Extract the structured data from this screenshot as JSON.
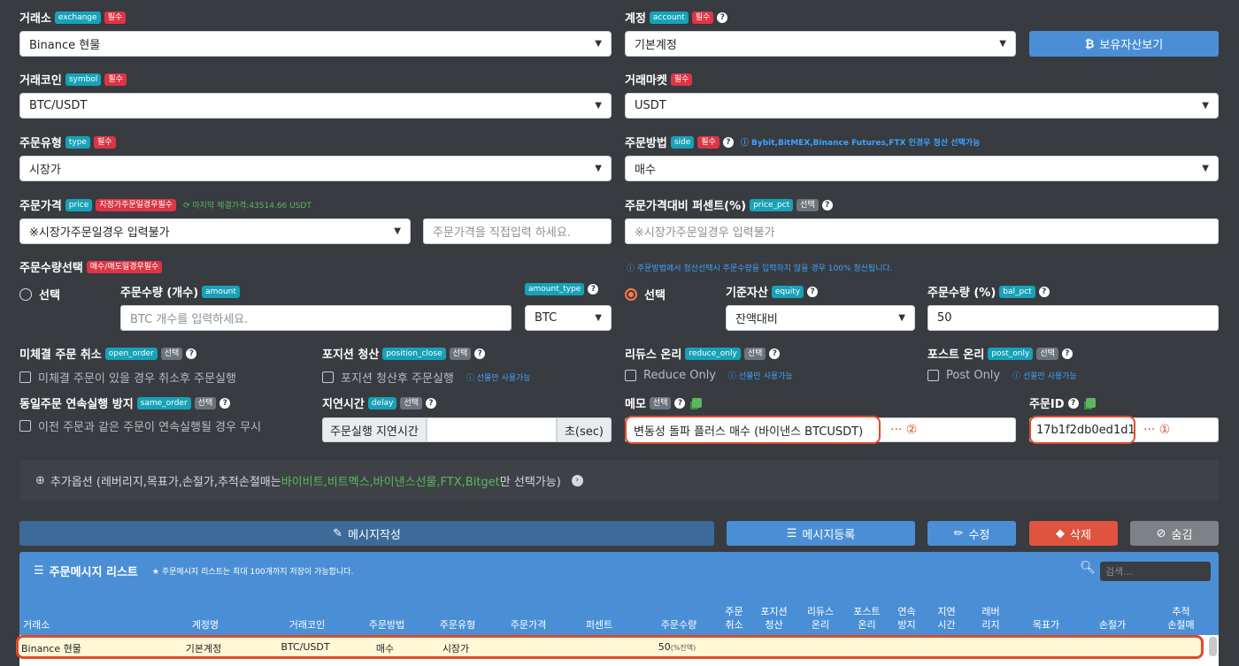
{
  "tags": {
    "required": "필수",
    "optional": "선택"
  },
  "exchange": {
    "label": "거래소",
    "tag": "exchange",
    "value": "Binance 현물"
  },
  "account": {
    "label": "계정",
    "tag": "account",
    "value": "기본계정",
    "asset_button": "보유자산보기"
  },
  "symbol": {
    "label": "거래코인",
    "tag": "symbol",
    "value": "BTC/USDT"
  },
  "market": {
    "label": "거래마켓",
    "value": "USDT"
  },
  "order_type": {
    "label": "주문유형",
    "tag": "type",
    "value": "시장가"
  },
  "side": {
    "label": "주문방법",
    "tag": "side",
    "note": "Bybit,BitMEX,Binance Futures,FTX 인경우 청산 선택가능",
    "value": "매수"
  },
  "price": {
    "label": "주문가격",
    "tag": "price",
    "tag_req": "지정가주문일경우필수",
    "last_price": "마지막 체결가격:43514.66 USDT",
    "select_value": "※시장가주문일경우 입력불가",
    "placeholder": "주문가격을 직접입력 하세요."
  },
  "price_pct": {
    "label": "주문가격대비 퍼센트(%)",
    "tag": "price_pct",
    "placeholder": "※시장가주문일경우 입력불가"
  },
  "amount_select": {
    "label": "주문수량선택",
    "tag": "매수/매도일경우필수",
    "note": "주문방법에서 청산선택시 주문수량을 입력하지 않을 경우 100% 청산됩니다.",
    "radio_label": "선택"
  },
  "amount": {
    "label": "주문수량 (개수)",
    "tag": "amount",
    "placeholder": "BTC 개수를 입력하세요.",
    "type_tag": "amount_type",
    "type_value": "BTC"
  },
  "equity": {
    "label": "기준자산",
    "tag": "equity",
    "value": "잔액대비",
    "radio_label": "선택"
  },
  "bal_pct": {
    "label": "주문수량 (%)",
    "tag": "bal_pct",
    "value": "50"
  },
  "open_order": {
    "label": "미체결 주문 취소",
    "tag": "open_order",
    "check_label": "미체결 주문이 있을 경우 취소후 주문실행"
  },
  "position_close": {
    "label": "포지션 청산",
    "tag": "position_close",
    "check_label": "포지션 청산후 주문실행",
    "note": "선물만 사용가능"
  },
  "reduce_only": {
    "label": "리듀스 온리",
    "tag": "reduce_only",
    "check_label": "Reduce Only",
    "note": "선물만 사용가능"
  },
  "post_only": {
    "label": "포스트 온리",
    "tag": "post_only",
    "check_label": "Post Only",
    "note": "선물만 사용가능"
  },
  "same_order": {
    "label": "동일주문 연속실행 방지",
    "tag": "same_order",
    "check_label": "이전 주문과 같은 주문이 연속실행될 경우 무시"
  },
  "delay": {
    "label": "지연시간",
    "tag": "delay",
    "prefix": "주문실행 지연시간",
    "suffix": "초(sec)"
  },
  "memo": {
    "label": "메모",
    "value": "변동성 돌파 플러스 매수 (바이낸스 BTCUSDT)",
    "callout": "··· ②"
  },
  "order_id": {
    "label": "주문ID",
    "value": "17b1f2db0ed1d1",
    "callout": "··· ①"
  },
  "extra": {
    "prefix": "추가옵션 (레버리지,목표가,손절가,추적손절매는 ",
    "exchanges": "바이비트,비트멕스,바이낸스선물,FTX,Bitget",
    "suffix": "만 선택가능)"
  },
  "buttons": {
    "write": "메시지작성",
    "register": "메시지등록",
    "edit": "수정",
    "delete": "삭제",
    "hide": "숨김"
  },
  "list": {
    "title": "주문메시지 리스트",
    "note": "주문메시지 리스트는 최대 100개까지 저장이 가능합니다.",
    "search_placeholder": "검색..."
  },
  "table": {
    "headers": [
      "거래소",
      "계정명",
      "거래코인",
      "주문방법",
      "주문유형",
      "주문가격",
      "퍼센트",
      "주문수량",
      "주문\n취소",
      "포지션\n청산",
      "리듀스\n온리",
      "포스트\n온리",
      "연속\n방지",
      "지연\n시간",
      "레버\n리지",
      "목표가",
      "손절가",
      "추적\n손절매"
    ],
    "row": [
      "Binance 현물",
      "기본계정",
      "BTC/USDT",
      "매수",
      "시장가",
      "",
      "",
      "50",
      "",
      "",
      "",
      "",
      "",
      "",
      "",
      "",
      "",
      ""
    ],
    "row_amount_suffix": "(%잔액)"
  },
  "colors": {
    "bg": "#383b40",
    "primary": "#4a8fd6",
    "danger": "#e0533f",
    "accent_ring": "#e24a2a",
    "note": "#3fa3ff",
    "green": "#5cb85c"
  }
}
